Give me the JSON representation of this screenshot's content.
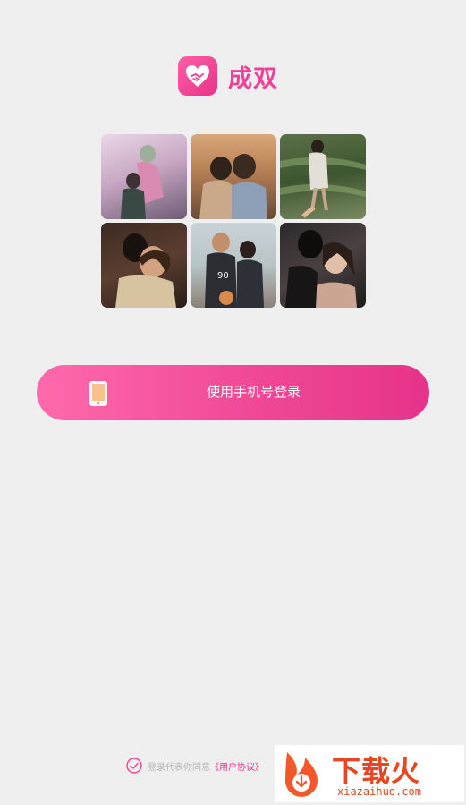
{
  "app": {
    "name": "成双"
  },
  "photos": [
    {
      "name": "couple-photo-1"
    },
    {
      "name": "couple-photo-2"
    },
    {
      "name": "couple-photo-3"
    },
    {
      "name": "couple-photo-4"
    },
    {
      "name": "couple-photo-5"
    },
    {
      "name": "couple-photo-6"
    }
  ],
  "login": {
    "phone_label": "使用手机号登录",
    "icon": "phone-icon"
  },
  "agreement": {
    "prefix": "登录代表你同意",
    "link": "《用户协议》"
  },
  "watermark": {
    "title": "下载火",
    "url": "xiazaihuo.com"
  },
  "colors": {
    "accent": "#ee4096",
    "background": "#efefef"
  }
}
